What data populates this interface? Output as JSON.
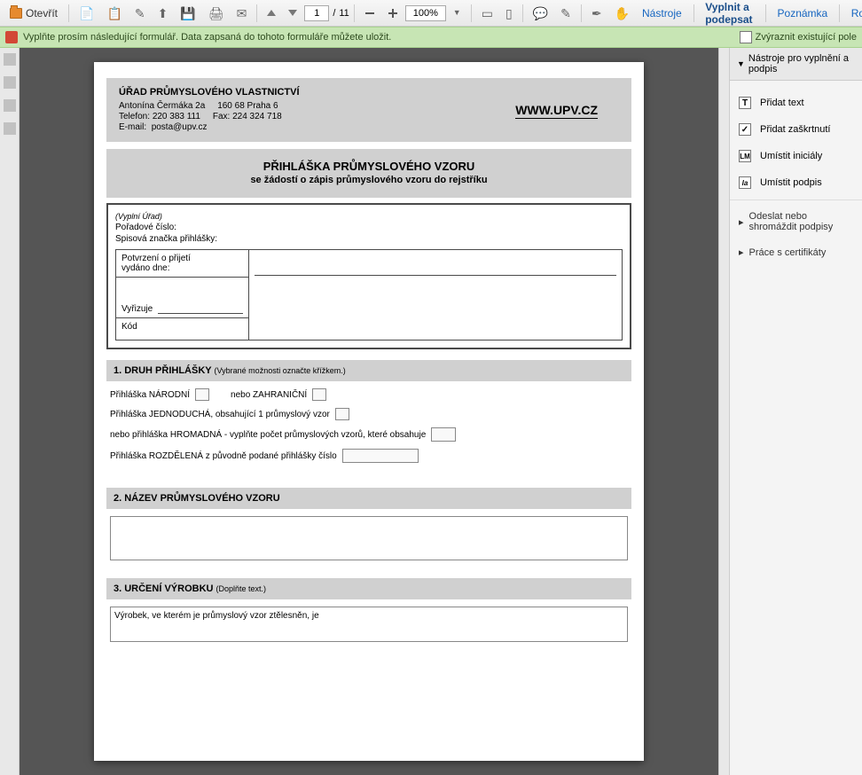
{
  "toolbar": {
    "open": "Otevřít",
    "page_current": "1",
    "page_sep": "/",
    "page_total": "11",
    "zoom": "100%",
    "tools": "Nástroje",
    "fill_sign": "Vyplnit a podepsat",
    "comment": "Poznámka",
    "extended": "Rozšířené"
  },
  "msgbar": {
    "text": "Vyplňte prosím následující formulář. Data zapsaná do tohoto formuláře můžete uložit.",
    "highlight": "Zvýraznit existující pole"
  },
  "panel": {
    "header": "Nástroje pro vyplnění a podpis",
    "add_text": "Přidat text",
    "add_check": "Přidat zaškrtnutí",
    "place_initials": "Umístit iniciály",
    "place_signature": "Umístit podpis",
    "send": "Odeslat nebo shromáždit podpisy",
    "certs": "Práce s certifikáty"
  },
  "doc": {
    "office_title": "ÚŘAD PRŮMYSLOVÉHO VLASTNICTVÍ",
    "addr1a": "Antonína Čermáka 2a",
    "addr1b": "160 68  Praha 6",
    "tel_label": "Telefon:",
    "tel": "220 383 111",
    "fax_label": "Fax:",
    "fax": "224 324 718",
    "email_label": "E-mail:",
    "email": "posta@upv.cz",
    "website": "WWW.UPV.CZ",
    "title_main": "PŘIHLÁŠKA PRŮMYSLOVÉHO VZORU",
    "title_sub": "se žádostí o zápis průmyslového vzoru do rejstříku",
    "meta_note": "(Vyplní Úřad)",
    "meta_seq": "Pořadové číslo:",
    "meta_fileno": "Spisová značka přihlášky:",
    "meta_receipt1": "Potvrzení o přijetí",
    "meta_receipt2": "vydáno dne:",
    "meta_handler": "Vyřizuje",
    "meta_code": "Kód",
    "s1_title": "1. DRUH PŘIHLÁŠKY",
    "s1_hint": "(Vybrané možnosti označte křížkem.)",
    "s1_national": "Přihláška NÁRODNÍ",
    "s1_or": "nebo ZAHRANIČNÍ",
    "s1_single": "Přihláška JEDNODUCHÁ, obsahující 1 průmyslový vzor",
    "s1_multi": "nebo přihláška HROMADNÁ - vyplňte počet průmyslových vzorů, které obsahuje",
    "s1_divided": "Přihláška ROZDĚLENÁ z původně podané přihlášky číslo",
    "s2_title": "2. NÁZEV PRŮMYSLOVÉHO VZORU",
    "s3_title": "3. URČENÍ VÝROBKU",
    "s3_hint": "(Doplňte text.)",
    "s3_text": "Výrobek, ve kterém je průmyslový vzor ztělesněn, je"
  }
}
